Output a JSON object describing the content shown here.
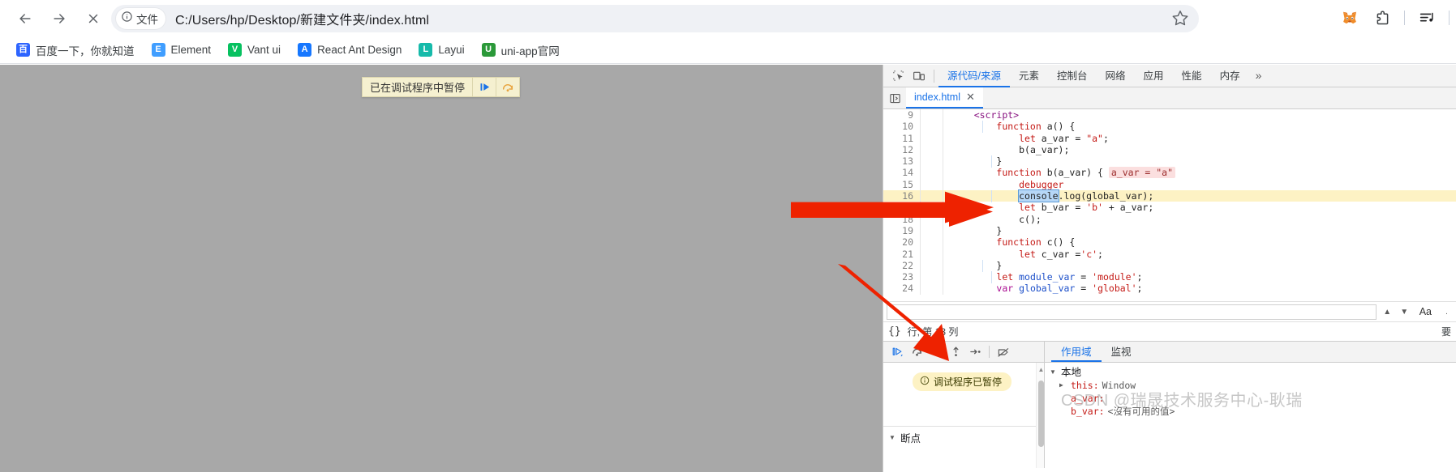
{
  "browser": {
    "nav": {
      "back_label": "后退",
      "forward_label": "前进",
      "stop_label": "停止"
    },
    "omnibox": {
      "security_label": "文件",
      "url": "C:/Users/hp/Desktop/新建文件夹/index.html",
      "bookmark_label": "为此标签页添加书签"
    },
    "toolbar_right": [
      {
        "name": "metamask-extension-icon",
        "label": "MetaMask"
      },
      {
        "name": "extensions-icon",
        "label": "扩展程序"
      },
      {
        "name": "media-list-icon",
        "label": "媒体列表"
      }
    ],
    "bookmarks": [
      {
        "label": "百度一下，你就知道",
        "icon": "baidu-icon",
        "color": "#2d64ff",
        "glyph": "百"
      },
      {
        "label": "Element",
        "icon": "element-icon",
        "color": "#409eff",
        "glyph": "E"
      },
      {
        "label": "Vant ui",
        "icon": "vant-icon",
        "color": "#07c160",
        "glyph": "V"
      },
      {
        "label": "React Ant Design",
        "icon": "antdesign-icon",
        "color": "#1677ff",
        "glyph": "A"
      },
      {
        "label": "Layui",
        "icon": "layui-icon",
        "color": "#16baaa",
        "glyph": "L"
      },
      {
        "label": "uni-app官网",
        "icon": "uniapp-icon",
        "color": "#2b9939",
        "glyph": "U"
      }
    ]
  },
  "page": {
    "debugger_bar": {
      "text": "已在调试程序中暂停",
      "resume_label": "恢复脚本执行",
      "step_label": "跳过下一个函数调用"
    }
  },
  "devtools": {
    "toolbar_icons": [
      {
        "name": "inspect-element-icon",
        "label": "检查元素"
      },
      {
        "name": "device-toolbar-icon",
        "label": "切换设备工具栏"
      }
    ],
    "tabs": [
      {
        "label": "源代码/来源",
        "active": true
      },
      {
        "label": "元素",
        "active": false
      },
      {
        "label": "控制台",
        "active": false
      },
      {
        "label": "网络",
        "active": false
      },
      {
        "label": "应用",
        "active": false
      },
      {
        "label": "性能",
        "active": false
      },
      {
        "label": "内存",
        "active": false
      }
    ],
    "more_tabs_label": "»",
    "file_tab": {
      "name": "index.html",
      "close_label": "✕",
      "panel_toggle_label": "显示导航器"
    },
    "code": {
      "lines": [
        {
          "num": "9",
          "indent": 4,
          "highlight": false,
          "tokens": [
            {
              "t": "<script>",
              "c": "tag"
            }
          ]
        },
        {
          "num": "10",
          "indent": 8,
          "highlight": false,
          "tokens": [
            {
              "t": "function",
              "c": "kw"
            },
            {
              "t": " a() {",
              "c": "plain"
            }
          ]
        },
        {
          "num": "11",
          "indent": 12,
          "highlight": false,
          "tokens": [
            {
              "t": "let",
              "c": "kw"
            },
            {
              "t": " a_var = ",
              "c": "plain"
            },
            {
              "t": "\"a\"",
              "c": "str"
            },
            {
              "t": ";",
              "c": "plain"
            }
          ]
        },
        {
          "num": "12",
          "indent": 12,
          "highlight": false,
          "tokens": [
            {
              "t": "b(a_var);",
              "c": "plain"
            }
          ]
        },
        {
          "num": "13",
          "indent": 8,
          "highlight": false,
          "tokens": [
            {
              "t": "}",
              "c": "plain"
            }
          ]
        },
        {
          "num": "14",
          "indent": 8,
          "highlight": false,
          "tokens": [
            {
              "t": "function",
              "c": "kw"
            },
            {
              "t": " b(a_var) { ",
              "c": "plain"
            },
            {
              "t": "a_var = \"a\"",
              "c": "inline-val"
            }
          ]
        },
        {
          "num": "15",
          "indent": 12,
          "highlight": false,
          "tokens": [
            {
              "t": "debugger",
              "c": "kw"
            }
          ]
        },
        {
          "num": "16",
          "indent": 12,
          "highlight": true,
          "tokens": [
            {
              "t": "console",
              "c": "sel-tok"
            },
            {
              "t": ".log(global_var);",
              "c": "plain"
            }
          ]
        },
        {
          "num": "17",
          "indent": 12,
          "highlight": false,
          "tokens": [
            {
              "t": "let",
              "c": "kw"
            },
            {
              "t": " b_var = ",
              "c": "plain"
            },
            {
              "t": "'b'",
              "c": "str"
            },
            {
              "t": " + a_var;",
              "c": "plain"
            }
          ]
        },
        {
          "num": "18",
          "indent": 12,
          "highlight": false,
          "tokens": [
            {
              "t": "c();",
              "c": "plain"
            }
          ]
        },
        {
          "num": "19",
          "indent": 8,
          "highlight": false,
          "tokens": [
            {
              "t": "}",
              "c": "plain"
            }
          ]
        },
        {
          "num": "20",
          "indent": 8,
          "highlight": false,
          "tokens": [
            {
              "t": "function",
              "c": "kw"
            },
            {
              "t": " c() {",
              "c": "plain"
            }
          ]
        },
        {
          "num": "21",
          "indent": 12,
          "highlight": false,
          "tokens": [
            {
              "t": "let",
              "c": "kw"
            },
            {
              "t": " c_var =",
              "c": "plain"
            },
            {
              "t": "'c'",
              "c": "str"
            },
            {
              "t": ";",
              "c": "plain"
            }
          ]
        },
        {
          "num": "22",
          "indent": 8,
          "highlight": false,
          "tokens": [
            {
              "t": "}",
              "c": "plain"
            }
          ]
        },
        {
          "num": "23",
          "indent": 8,
          "highlight": false,
          "tokens": [
            {
              "t": "let",
              "c": "kw"
            },
            {
              "t": " ",
              "c": "plain"
            },
            {
              "t": "module_var",
              "c": "var"
            },
            {
              "t": " = ",
              "c": "plain"
            },
            {
              "t": "'module'",
              "c": "str"
            },
            {
              "t": ";",
              "c": "plain"
            }
          ]
        },
        {
          "num": "24",
          "indent": 8,
          "highlight": false,
          "tokens": [
            {
              "t": "var",
              "c": "kw2"
            },
            {
              "t": " ",
              "c": "plain"
            },
            {
              "t": "global_var",
              "c": "var"
            },
            {
              "t": " = ",
              "c": "plain"
            },
            {
              "t": "'global'",
              "c": "str"
            },
            {
              "t": ";",
              "c": "plain"
            }
          ]
        }
      ]
    },
    "search": {
      "placeholder": "",
      "prev_label": "▲",
      "next_label": "▼",
      "match_case_label": "Aa"
    },
    "status": {
      "format_label": "{}",
      "position": "行, 第 13 列",
      "right_label": "要"
    },
    "debugger": {
      "controls": [
        {
          "name": "resume-script-button",
          "label": "恢复脚本执行",
          "glyph": "resume"
        },
        {
          "name": "step-over-button",
          "label": "跳过下一个函数调用",
          "glyph": "step-over"
        },
        {
          "name": "step-into-button",
          "label": "单步调试进入下一个函数调用",
          "glyph": "step-into"
        },
        {
          "name": "step-out-button",
          "label": "单步调试跳出当前函数",
          "glyph": "step-out"
        },
        {
          "name": "step-button",
          "label": "单步执行",
          "glyph": "step"
        },
        {
          "name": "deactivate-breakpoints-button",
          "label": "停用断点",
          "glyph": "deactivate"
        }
      ],
      "paused_badge": "调试程序已暂停",
      "paused_badge_icon": "info-icon",
      "breakpoints_section": "断点",
      "breakpoints_expanded": true
    },
    "scope": {
      "tabs": [
        {
          "label": "作用域",
          "active": true
        },
        {
          "label": "监视",
          "active": false
        }
      ],
      "tree": [
        {
          "depth": 0,
          "arrow": "▼",
          "label": "本地",
          "type": "cn"
        },
        {
          "depth": 1,
          "arrow": "▶",
          "name": "this",
          "value": "Window",
          "type": "code"
        },
        {
          "depth": 1,
          "arrow": "",
          "name": "a_var",
          "value": "",
          "type": "code"
        },
        {
          "depth": 1,
          "arrow": "",
          "name": "b_var",
          "value": "<沒有可用的值>",
          "type": "code"
        }
      ]
    }
  },
  "watermark": "CSDN @瑞晟技术服务中心-耿瑞"
}
